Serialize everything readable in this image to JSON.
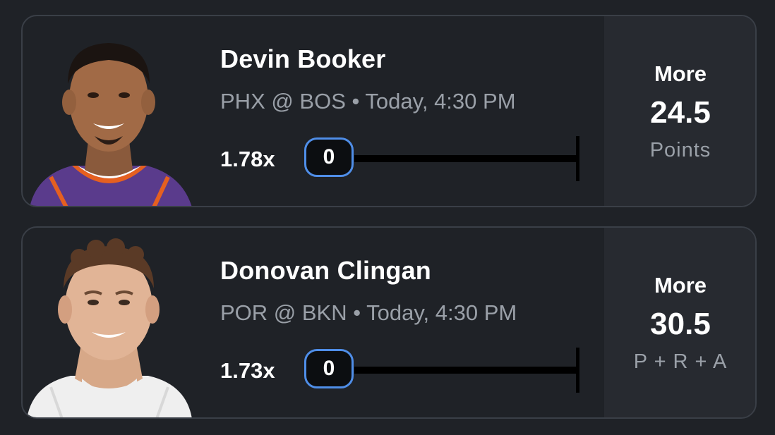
{
  "colors": {
    "background": "#1f2227",
    "card_border": "#3a3f47",
    "stat_panel": "#272a30",
    "muted_text": "#9aa0a8",
    "pill_border": "#4f8ee8",
    "suns_purple": "#5a3b8c",
    "suns_orange": "#e56020"
  },
  "players": [
    {
      "name": "Devin Booker",
      "matchup": "PHX @ BOS • Today, 4:30 PM",
      "multiplier": "1.78x",
      "progress_value": "0",
      "direction": "More",
      "line": "24.5",
      "stat_type": "Points"
    },
    {
      "name": "Donovan Clingan",
      "matchup": "POR @ BKN • Today, 4:30 PM",
      "multiplier": "1.73x",
      "progress_value": "0",
      "direction": "More",
      "line": "30.5",
      "stat_type": "P + R + A"
    }
  ]
}
